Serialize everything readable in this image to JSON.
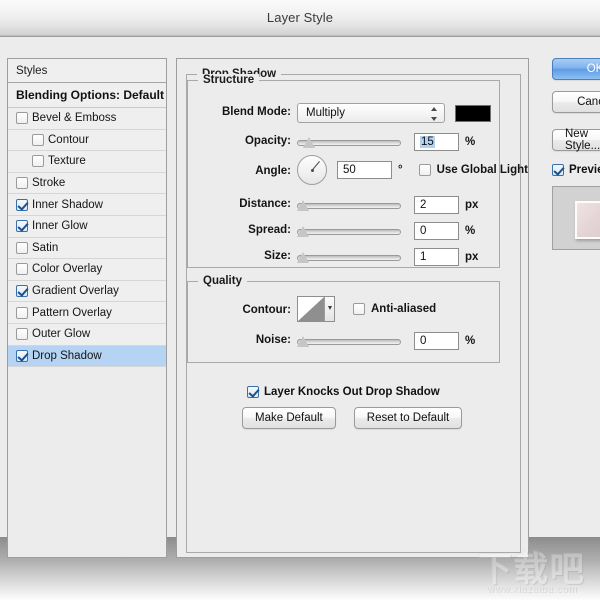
{
  "window": {
    "title": "Layer Style"
  },
  "styles_panel": {
    "header": "Styles",
    "blending_options": "Blending Options: Default",
    "effects": [
      {
        "label": "Bevel & Emboss",
        "checked": false,
        "indent": false,
        "selected": false
      },
      {
        "label": "Contour",
        "checked": false,
        "indent": true,
        "selected": false
      },
      {
        "label": "Texture",
        "checked": false,
        "indent": true,
        "selected": false
      },
      {
        "label": "Stroke",
        "checked": false,
        "indent": false,
        "selected": false
      },
      {
        "label": "Inner Shadow",
        "checked": true,
        "indent": false,
        "selected": false
      },
      {
        "label": "Inner Glow",
        "checked": true,
        "indent": false,
        "selected": false
      },
      {
        "label": "Satin",
        "checked": false,
        "indent": false,
        "selected": false
      },
      {
        "label": "Color Overlay",
        "checked": false,
        "indent": false,
        "selected": false
      },
      {
        "label": "Gradient Overlay",
        "checked": true,
        "indent": false,
        "selected": false
      },
      {
        "label": "Pattern Overlay",
        "checked": false,
        "indent": false,
        "selected": false
      },
      {
        "label": "Outer Glow",
        "checked": false,
        "indent": false,
        "selected": false
      },
      {
        "label": "Drop Shadow",
        "checked": true,
        "indent": false,
        "selected": true
      }
    ]
  },
  "main": {
    "panel_title": "Drop Shadow",
    "structure": {
      "legend": "Structure",
      "blend_mode_label": "Blend Mode:",
      "blend_mode_value": "Multiply",
      "shadow_color": "#000000",
      "opacity_label": "Opacity:",
      "opacity_value": "15",
      "opacity_unit": "%",
      "angle_label": "Angle:",
      "angle_value": "50",
      "angle_unit": "°",
      "angle_degrees": 50,
      "use_global_light_label": "Use Global Light",
      "use_global_light_checked": false,
      "distance_label": "Distance:",
      "distance_value": "2",
      "distance_unit": "px",
      "spread_label": "Spread:",
      "spread_value": "0",
      "spread_unit": "%",
      "size_label": "Size:",
      "size_value": "1",
      "size_unit": "px"
    },
    "quality": {
      "legend": "Quality",
      "contour_label": "Contour:",
      "anti_aliased_label": "Anti-aliased",
      "anti_aliased_checked": false,
      "noise_label": "Noise:",
      "noise_value": "0",
      "noise_unit": "%"
    },
    "footer": {
      "knockout_label": "Layer Knocks Out Drop Shadow",
      "knockout_checked": true,
      "make_default": "Make Default",
      "reset_to_default": "Reset to Default"
    }
  },
  "right_column": {
    "ok": "OK",
    "cancel": "Cancel",
    "new_style": "New Style...",
    "preview_label": "Preview",
    "preview_checked": true
  },
  "watermark": {
    "text_cn": "下载吧",
    "url": "www.xiazaiba.com"
  },
  "colors": {
    "selection_blue": "#b5d3f2",
    "primary_button": "#5d9ce8",
    "window_bg": "#ececec"
  }
}
